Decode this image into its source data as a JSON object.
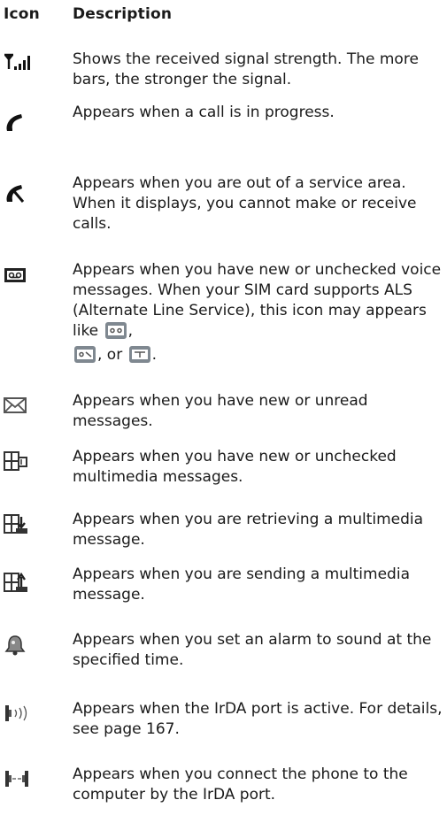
{
  "header": {
    "icon_col": "Icon",
    "desc_col": "Description"
  },
  "rows": [
    {
      "icon": "signal-strength-icon",
      "text": "Shows the received signal strength. The more bars, the stronger the signal."
    },
    {
      "icon": "call-in-progress-icon",
      "text": "Appears when a call is in progress."
    },
    {
      "icon": "no-service-icon",
      "text": "Appears when you are out of a service area. When it displays, you cannot make or receive calls."
    },
    {
      "icon": "voicemail-icon",
      "text_a": "Appears when you have new or unchecked voice messages. When your SIM card supports ALS (Alternate Line Service), this icon may appears like",
      "sep1": ",",
      "sep2": ", or",
      "sep3": "."
    },
    {
      "icon": "envelope-icon",
      "text": "Appears when you have new or unread messages."
    },
    {
      "icon": "multimedia-message-icon",
      "text": "Appears when you have new or unchecked multimedia messages."
    },
    {
      "icon": "mms-retrieving-icon",
      "text": "Appears when you are retrieving a multimedia message."
    },
    {
      "icon": "mms-sending-icon",
      "text": "Appears when you are sending a multimedia message."
    },
    {
      "icon": "alarm-icon",
      "text": "Appears when you set an alarm to sound at the specified time."
    },
    {
      "icon": "irda-active-icon",
      "text": "Appears when the IrDA port is active. For details, see page 167."
    },
    {
      "icon": "irda-connected-icon",
      "text": "Appears when you connect the phone to the computer by the IrDA port."
    }
  ]
}
